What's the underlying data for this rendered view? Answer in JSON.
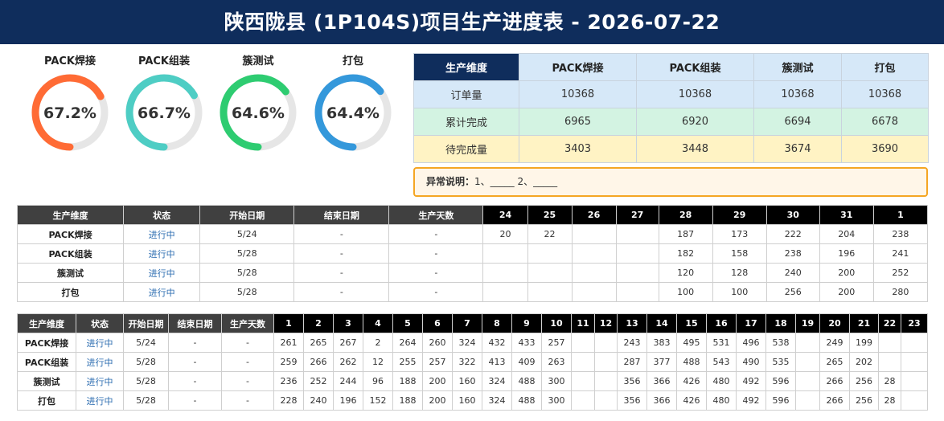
{
  "title": "陕西陇县 (1P104S)项目生产进度表 - 2026-07-22",
  "gauges": [
    {
      "label": "PACK焊接",
      "value_text": "67.2%",
      "percent": 67.2,
      "color": "#ff6b35"
    },
    {
      "label": "PACK组装",
      "value_text": "66.7%",
      "percent": 66.7,
      "color": "#4ecdc4"
    },
    {
      "label": "簇测试",
      "value_text": "64.6%",
      "percent": 64.6,
      "color": "#2ecc71"
    },
    {
      "label": "打包",
      "value_text": "64.4%",
      "percent": 64.4,
      "color": "#3498db"
    }
  ],
  "summary": {
    "header": [
      "生产维度",
      "PACK焊接",
      "PACK组装",
      "簇测试",
      "打包"
    ],
    "rows": [
      {
        "label": "订单量",
        "values": [
          "10368",
          "10368",
          "10368",
          "10368"
        ]
      },
      {
        "label": "累计完成",
        "values": [
          "6965",
          "6920",
          "6694",
          "6678"
        ]
      },
      {
        "label": "待完成量",
        "values": [
          "3403",
          "3448",
          "3674",
          "3690"
        ]
      }
    ]
  },
  "anomaly": {
    "label": "异常说明：",
    "text": "1、_____    2、_____"
  },
  "table1": {
    "headers": [
      "生产维度",
      "状态",
      "开始日期",
      "结束日期",
      "生产天数"
    ],
    "days": [
      "24",
      "25",
      "26",
      "27",
      "28",
      "29",
      "30",
      "31",
      "1"
    ],
    "rows": [
      {
        "dim": "PACK焊接",
        "status": "进行中",
        "start": "5/24",
        "end": "-",
        "days": "-",
        "values": [
          "20",
          "22",
          "",
          "",
          "187",
          "173",
          "222",
          "204",
          "238"
        ]
      },
      {
        "dim": "PACK组装",
        "status": "进行中",
        "start": "5/28",
        "end": "-",
        "days": "-",
        "values": [
          "",
          "",
          "",
          "",
          "182",
          "158",
          "238",
          "196",
          "241"
        ]
      },
      {
        "dim": "簇测试",
        "status": "进行中",
        "start": "5/28",
        "end": "-",
        "days": "-",
        "values": [
          "",
          "",
          "",
          "",
          "120",
          "128",
          "240",
          "200",
          "252"
        ]
      },
      {
        "dim": "打包",
        "status": "进行中",
        "start": "5/28",
        "end": "-",
        "days": "-",
        "values": [
          "",
          "",
          "",
          "",
          "100",
          "100",
          "256",
          "200",
          "280"
        ]
      }
    ]
  },
  "table2": {
    "headers": [
      "生产维度",
      "状态",
      "开始日期",
      "结束日期",
      "生产天数"
    ],
    "days": [
      "1",
      "2",
      "3",
      "4",
      "5",
      "6",
      "7",
      "8",
      "9",
      "10",
      "11",
      "12",
      "13",
      "14",
      "15",
      "16",
      "17",
      "18",
      "19",
      "20",
      "21",
      "22",
      "23"
    ],
    "rows": [
      {
        "dim": "PACK焊接",
        "status": "进行中",
        "start": "5/24",
        "end": "-",
        "days": "-",
        "values": [
          "261",
          "265",
          "267",
          "2",
          "264",
          "260",
          "324",
          "432",
          "433",
          "257",
          "",
          "",
          "243",
          "383",
          "495",
          "531",
          "496",
          "538",
          "",
          "249",
          "199",
          "",
          ""
        ]
      },
      {
        "dim": "PACK组装",
        "status": "进行中",
        "start": "5/28",
        "end": "-",
        "days": "-",
        "values": [
          "259",
          "266",
          "262",
          "12",
          "255",
          "257",
          "322",
          "413",
          "409",
          "263",
          "",
          "",
          "287",
          "377",
          "488",
          "543",
          "490",
          "535",
          "",
          "265",
          "202",
          "",
          ""
        ]
      },
      {
        "dim": "簇测试",
        "status": "进行中",
        "start": "5/28",
        "end": "-",
        "days": "-",
        "values": [
          "236",
          "252",
          "244",
          "96",
          "188",
          "200",
          "160",
          "324",
          "488",
          "300",
          "",
          "",
          "356",
          "366",
          "426",
          "480",
          "492",
          "596",
          "",
          "266",
          "256",
          "28",
          ""
        ]
      },
      {
        "dim": "打包",
        "status": "进行中",
        "start": "5/28",
        "end": "-",
        "days": "-",
        "values": [
          "228",
          "240",
          "196",
          "152",
          "188",
          "200",
          "160",
          "324",
          "488",
          "300",
          "",
          "",
          "356",
          "366",
          "426",
          "480",
          "492",
          "596",
          "",
          "266",
          "256",
          "28",
          ""
        ]
      }
    ]
  }
}
